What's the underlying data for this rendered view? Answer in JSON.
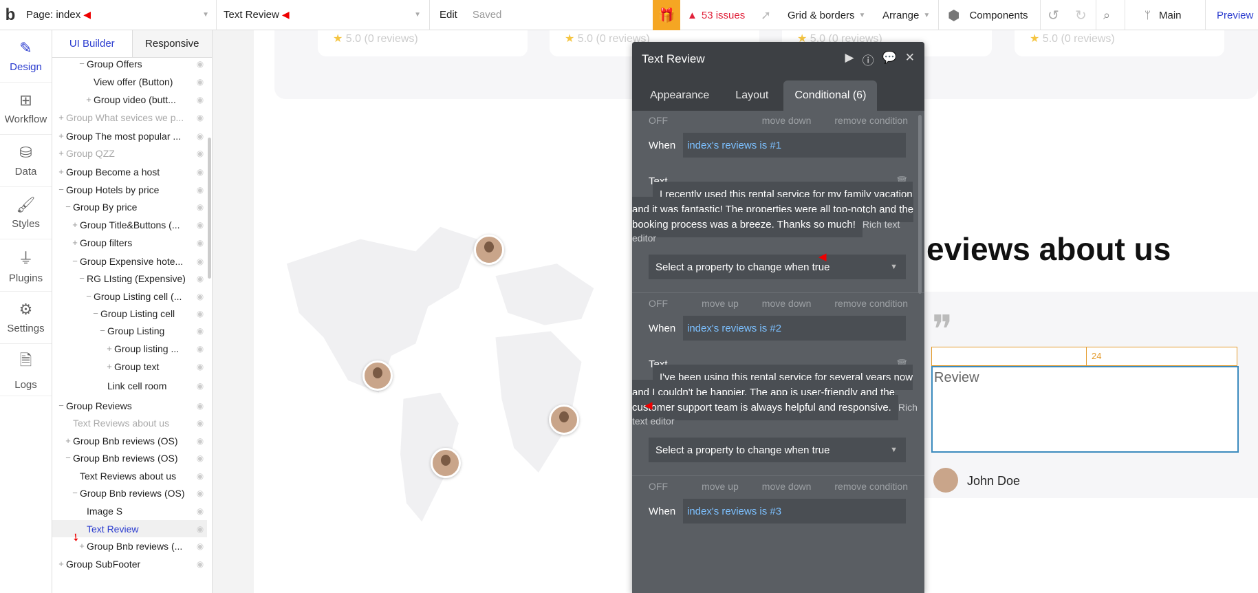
{
  "topbar": {
    "logo": "b",
    "page_selector": "Page: index",
    "element_selector": "Text Review",
    "edit": "Edit",
    "saved": "Saved",
    "issues": "53 issues",
    "grid_borders": "Grid & borders",
    "arrange": "Arrange",
    "components": "Components",
    "branch": "Main",
    "preview": "Preview"
  },
  "iconbar": [
    {
      "label": "Design",
      "icon": "design-icon"
    },
    {
      "label": "Workflow",
      "icon": "workflow-icon"
    },
    {
      "label": "Data",
      "icon": "database-icon"
    },
    {
      "label": "Styles",
      "icon": "brush-icon"
    },
    {
      "label": "Plugins",
      "icon": "plug-icon"
    },
    {
      "label": "Settings",
      "icon": "gear-icon"
    },
    {
      "label": "Logs",
      "icon": "document-icon"
    }
  ],
  "tree": {
    "tabs": [
      "UI Builder",
      "Responsive"
    ],
    "rows": [
      {
        "label": "Group Offers",
        "sign": "−",
        "level": 3,
        "style": "normal"
      },
      {
        "label": "View offer (Button)",
        "sign": "",
        "level": 4,
        "style": "normal"
      },
      {
        "label": "Group video (butt...",
        "sign": "+",
        "level": 4,
        "style": "normal"
      },
      {
        "label": "Group What sevices we p...",
        "sign": "+",
        "level": 0,
        "style": "dim"
      },
      {
        "label": "Group The most popular ...",
        "sign": "+",
        "level": 0,
        "style": "normal"
      },
      {
        "label": "Group QZZ",
        "sign": "+",
        "level": 0,
        "style": "dim"
      },
      {
        "label": "Group Become a host",
        "sign": "+",
        "level": 0,
        "style": "normal"
      },
      {
        "label": "Group Hotels by price",
        "sign": "−",
        "level": 0,
        "style": "normal"
      },
      {
        "label": "Group By price",
        "sign": "−",
        "level": 1,
        "style": "normal"
      },
      {
        "label": "Group Title&Buttons (...",
        "sign": "+",
        "level": 2,
        "style": "normal"
      },
      {
        "label": "Group filters",
        "sign": "+",
        "level": 2,
        "style": "normal"
      },
      {
        "label": "Group Expensive hote...",
        "sign": "−",
        "level": 2,
        "style": "normal"
      },
      {
        "label": "RG LIsting (Expensive)",
        "sign": "−",
        "level": 3,
        "style": "normal"
      },
      {
        "label": "Group Listing cell (...",
        "sign": "−",
        "level": 4,
        "style": "normal"
      },
      {
        "label": "Group Listing cell",
        "sign": "−",
        "level": 5,
        "style": "normal"
      },
      {
        "label": "Group Listing",
        "sign": "−",
        "level": 6,
        "style": "normal"
      },
      {
        "label": "Group listing ...",
        "sign": "+",
        "level": 7,
        "style": "normal"
      },
      {
        "label": "Group text",
        "sign": "+",
        "level": 7,
        "style": "normal"
      },
      {
        "label": "Link cell room",
        "sign": "",
        "level": 6,
        "style": "normal"
      },
      {
        "label": "Group Reviews",
        "sign": "−",
        "level": 0,
        "style": "normal"
      },
      {
        "label": "Text Reviews about us",
        "sign": "",
        "level": 1,
        "style": "dim"
      },
      {
        "label": "Group Bnb reviews (OS)",
        "sign": "+",
        "level": 1,
        "style": "normal"
      },
      {
        "label": "Group Bnb reviews (OS)",
        "sign": "−",
        "level": 1,
        "style": "normal"
      },
      {
        "label": "Text Reviews about us",
        "sign": "",
        "level": 2,
        "style": "normal"
      },
      {
        "label": "Group Bnb reviews (OS)",
        "sign": "−",
        "level": 2,
        "style": "normal"
      },
      {
        "label": "Image S",
        "sign": "",
        "level": 3,
        "style": "normal"
      },
      {
        "label": "Text Review",
        "sign": "",
        "level": 3,
        "style": "selected"
      },
      {
        "label": "Group Bnb reviews (...",
        "sign": "+",
        "level": 3,
        "style": "normal"
      },
      {
        "label": "Group SubFooter",
        "sign": "+",
        "level": 0,
        "style": "normal"
      }
    ]
  },
  "canvas": {
    "rating": "5.0",
    "reviews_count": "(0 reviews)",
    "heading": "eviews about us",
    "selected_width": "24",
    "review_text": "Review",
    "author": "John Doe"
  },
  "property_editor": {
    "title": "Text Review",
    "tabs": [
      "Appearance",
      "Layout",
      "Conditional (6)"
    ],
    "active_tab": 2,
    "labels": {
      "off": "OFF",
      "move_up": "move up",
      "move_down": "move down",
      "remove": "remove condition",
      "when": "When",
      "text": "Text",
      "rich": "Rich text editor",
      "select": "Select a property to change when true"
    },
    "conditions": [
      {
        "expr": "index's reviews is #1",
        "text": "I recently used this rental service for my family vacation and it was fantastic! The properties were all top-notch and the booking process was a breeze. Thanks so much!",
        "has_move_up": false
      },
      {
        "expr": "index's reviews is #2",
        "text": "I've been using this rental service for several years now and I couldn't be happier. The app is user-friendly and the customer support team is always helpful and responsive.",
        "has_move_up": true
      },
      {
        "expr": "index's reviews is #3",
        "text": "",
        "has_move_up": true
      }
    ]
  },
  "colors": {
    "accent": "#2b3ccf",
    "issues": "#e0213a",
    "gift": "#f5a623",
    "editor_bg": "#5a5e63",
    "expr_link": "#7cc0ff"
  }
}
